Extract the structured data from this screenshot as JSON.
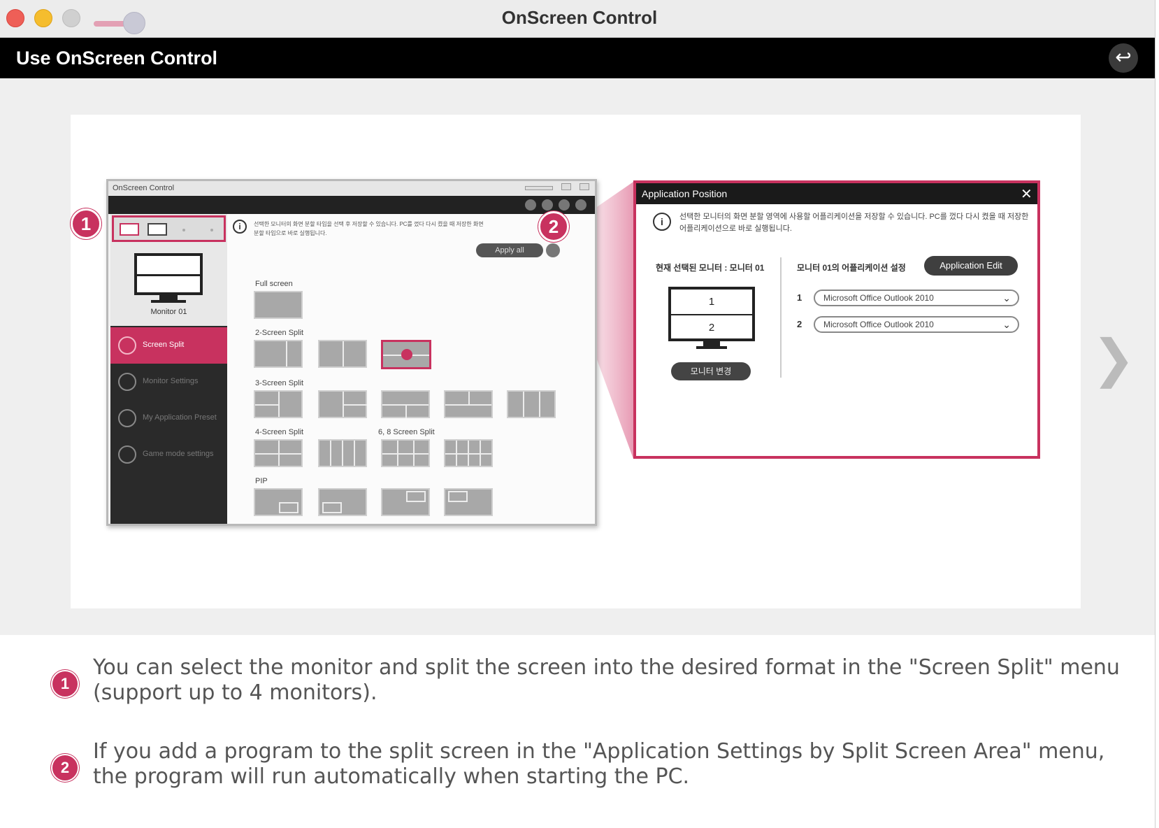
{
  "window": {
    "title": "OnScreen Control"
  },
  "header": {
    "title": "Use OnScreen Control",
    "back_icon": "↩"
  },
  "illustration": {
    "mini_app": {
      "title": "OnScreen Control",
      "info_text": "선택한 모니터의 화면 분할 타입을 선택 후 저장할 수 있습니다. PC를 껐다 다시 켰을 때 저장한 화면 분할 타입으로 바로 실행됩니다.",
      "apply_all": "Apply all",
      "monitor_label": "Monitor 01",
      "menu": [
        {
          "label": "Screen Split",
          "active": true
        },
        {
          "label": "Monitor Settings",
          "active": false
        },
        {
          "label": "My Application Preset",
          "active": false
        },
        {
          "label": "Game mode settings",
          "active": false
        }
      ],
      "sections": {
        "full": "Full screen",
        "two": "2-Screen Split",
        "three": "3-Screen Split",
        "four": "4-Screen Split",
        "six_eight": "6, 8 Screen Split",
        "pip": "PIP"
      }
    },
    "badges": [
      "1",
      "2"
    ],
    "app_dialog": {
      "title": "Application Position",
      "close": "✕",
      "info_text": "선택한 모니터의 화면 분할 영역에 사용할 어플리케이션을 저장할 수 있습니다. PC를 껐다 다시 켰을 때 저장한 어플리케이션으로 바로 실행됩니다.",
      "current_monitor": "현재 선택된 모니터 : 모니터 01",
      "monitor_areas": [
        "1",
        "2"
      ],
      "change_monitor": "모니터 변경",
      "settings_label": "모니터 01의 어플리케이션 설정",
      "app_edit": "Application Edit",
      "rows": [
        {
          "num": "1",
          "value": "Microsoft Office Outlook 2010"
        },
        {
          "num": "2",
          "value": "Microsoft Office Outlook 2010"
        }
      ]
    }
  },
  "next_arrow": "❯",
  "descriptions": [
    {
      "num": "1",
      "text": "You can select the monitor and split the screen into the desired format in the \"Screen Split\" menu (support up to 4 monitors)."
    },
    {
      "num": "2",
      "text": "If you add a program to the split screen in the \"Application Settings by Split Screen Area\" menu, the program will run automatically when starting the PC."
    }
  ],
  "colors": {
    "accent": "#c8325f",
    "header_bg": "#000000",
    "content_bg": "#efefef"
  }
}
